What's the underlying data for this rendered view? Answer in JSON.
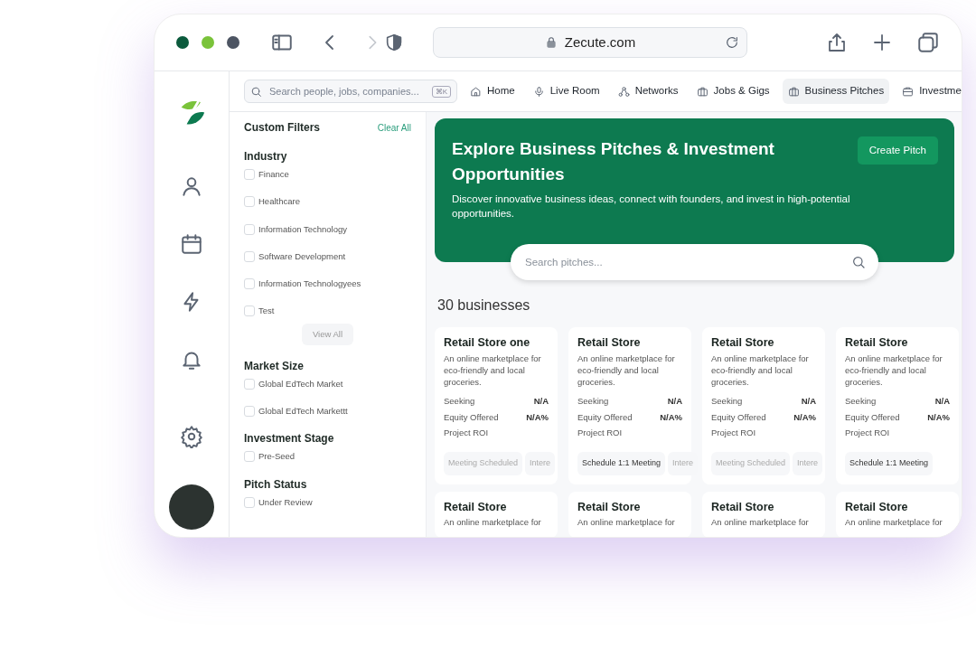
{
  "browser": {
    "address": "Zecute.com"
  },
  "topbar": {
    "search": {
      "placeholder": "Search people, jobs, companies...",
      "shortcut": "⌘K"
    },
    "nav": [
      {
        "label": "Home",
        "selected": false
      },
      {
        "label": "Live Room",
        "selected": false
      },
      {
        "label": "Networks",
        "selected": false
      },
      {
        "label": "Jobs & Gigs",
        "selected": false
      },
      {
        "label": "Business Pitches",
        "selected": true
      },
      {
        "label": "Investme",
        "selected": false
      }
    ]
  },
  "filters": {
    "title": "Custom Filters",
    "clear": "Clear All",
    "groups": [
      {
        "title": "Industry",
        "options": [
          {
            "label": "Finance",
            "checked": false
          },
          {
            "label": "Healthcare",
            "checked": false
          },
          {
            "label": "Information Technology",
            "checked": false
          },
          {
            "label": "Software Development",
            "checked": false
          },
          {
            "label": "Information Technologyees",
            "checked": false
          },
          {
            "label": "Test",
            "checked": false
          }
        ],
        "view_all": "View All"
      },
      {
        "title": "Market Size",
        "options": [
          {
            "label": "Global EdTech Market",
            "checked": false
          },
          {
            "label": "Global EdTech Markettt",
            "checked": false
          }
        ]
      },
      {
        "title": "Investment Stage",
        "options": [
          {
            "label": "Pre-Seed",
            "checked": false
          }
        ]
      },
      {
        "title": "Pitch Status",
        "options": [
          {
            "label": "Under Review",
            "checked": false
          }
        ]
      }
    ]
  },
  "hero": {
    "title": "Explore Business Pitches & Investment Opportunities",
    "subtitle": "Discover innovative business ideas, connect with founders, and invest in high-potential opportunities.",
    "button": "Create Pitch",
    "search": {
      "placeholder": "Search pitches..."
    }
  },
  "count": "30 businesses",
  "cards": [
    {
      "title": "Retail Store one",
      "description": "An online marketplace for eco-friendly and local groceries.",
      "stats": [
        {
          "label": "Seeking",
          "value": "N/A"
        },
        {
          "label": "Equity Offered",
          "value": "N/A%"
        },
        {
          "label": "Project ROI"
        }
      ],
      "actions": [
        {
          "label": "Meeting Scheduled",
          "disabled": true
        },
        {
          "label": "Intere",
          "disabled": true
        }
      ]
    },
    {
      "title": "Retail Store",
      "description": "An online marketplace for eco-friendly and local groceries.",
      "stats": [
        {
          "label": "Seeking",
          "value": "N/A"
        },
        {
          "label": "Equity Offered",
          "value": "N/A%"
        },
        {
          "label": "Project ROI"
        }
      ],
      "actions": [
        {
          "label": "Schedule 1:1 Meeting",
          "disabled": false
        },
        {
          "label": "Intere",
          "disabled": true
        }
      ]
    },
    {
      "title": "Retail Store",
      "description": "An online marketplace for eco-friendly and local groceries.",
      "stats": [
        {
          "label": "Seeking",
          "value": "N/A"
        },
        {
          "label": "Equity Offered",
          "value": "N/A%"
        },
        {
          "label": "Project ROI"
        }
      ],
      "actions": [
        {
          "label": "Meeting Scheduled",
          "disabled": true
        },
        {
          "label": "Intere",
          "disabled": true
        }
      ]
    },
    {
      "title": "Retail Store",
      "description": "An online marketplace for eco-friendly and local groceries.",
      "stats": [
        {
          "label": "Seeking",
          "value": "N/A"
        },
        {
          "label": "Equity Offered",
          "value": "N/A%"
        },
        {
          "label": "Project ROI"
        }
      ],
      "actions": [
        {
          "label": "Schedule 1:1 Meeting",
          "disabled": false
        }
      ]
    },
    {
      "title": "Retail Store",
      "description": "An online marketplace for"
    },
    {
      "title": "Retail Store",
      "description": "An online marketplace for"
    },
    {
      "title": "Retail Store",
      "description": "An online marketplace for"
    },
    {
      "title": "Retail Store",
      "description": "An online marketplace for"
    }
  ]
}
